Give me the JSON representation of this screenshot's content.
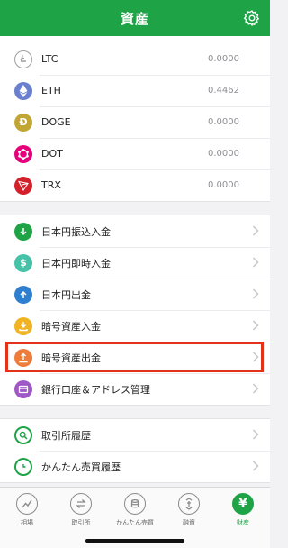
{
  "header": {
    "title": "資産"
  },
  "coins": [
    {
      "label": "LTC",
      "value": "0.0000",
      "icon": "litecoin-icon",
      "color": "#9e9e9e"
    },
    {
      "label": "ETH",
      "value": "0.4462",
      "icon": "ethereum-icon",
      "color": "#6b7fcf"
    },
    {
      "label": "DOGE",
      "value": "0.0000",
      "icon": "dogecoin-icon",
      "color": "#c2a633"
    },
    {
      "label": "DOT",
      "value": "0.0000",
      "icon": "polkadot-icon",
      "color": "#e6007a"
    },
    {
      "label": "TRX",
      "value": "0.0000",
      "icon": "tron-icon",
      "color": "#d3202a"
    }
  ],
  "actions": [
    {
      "label": "日本円振込入金",
      "icon": "jpy-deposit-icon",
      "color": "#1fa347"
    },
    {
      "label": "日本円即時入金",
      "icon": "jpy-instant-deposit-icon",
      "color": "#47c2a8"
    },
    {
      "label": "日本円出金",
      "icon": "jpy-withdraw-icon",
      "color": "#2f7fd1"
    },
    {
      "label": "暗号資産入金",
      "icon": "crypto-deposit-icon",
      "color": "#f0b323"
    },
    {
      "label": "暗号資産出金",
      "icon": "crypto-withdraw-icon",
      "color": "#ee7d3b"
    },
    {
      "label": "銀行口座＆アドレス管理",
      "icon": "bank-account-icon",
      "color": "#a058c8"
    }
  ],
  "history": [
    {
      "label": "取引所履歴",
      "icon": "exchange-history-icon",
      "color": "#1fa347"
    },
    {
      "label": "かんたん売買履歴",
      "icon": "simple-trade-history-icon",
      "color": "#1fa347"
    }
  ],
  "tabs": [
    {
      "label": "相場",
      "icon": "market-chart-icon"
    },
    {
      "label": "取引所",
      "icon": "exchange-icon"
    },
    {
      "label": "かんたん売買",
      "icon": "simple-trade-icon"
    },
    {
      "label": "融資",
      "icon": "lending-icon"
    },
    {
      "label": "財産",
      "icon": "yen-icon",
      "active": true,
      "glyph": "¥"
    }
  ],
  "colors": {
    "brand": "#1fa347",
    "highlight": "#e5311a"
  }
}
